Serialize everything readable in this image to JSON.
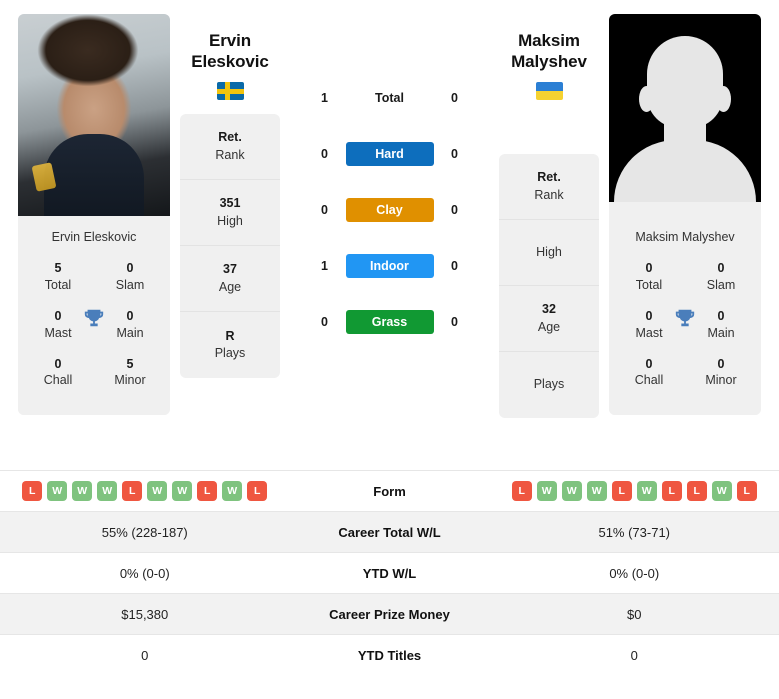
{
  "players": {
    "left": {
      "first_name": "Ervin",
      "last_name": "Eleskovic",
      "full_name": "Ervin Eleskovic",
      "flag": "sweden-flag",
      "photo": "player-portrait",
      "info": [
        {
          "value": "Ret.",
          "label": "Rank"
        },
        {
          "value": "351",
          "label": "High"
        },
        {
          "value": "37",
          "label": "Age"
        },
        {
          "value": "R",
          "label": "Plays"
        }
      ],
      "titles": {
        "total": "5",
        "total_label": "Total",
        "slam": "0",
        "slam_label": "Slam",
        "mast": "0",
        "mast_label": "Mast",
        "main": "0",
        "main_label": "Main",
        "chall": "0",
        "chall_label": "Chall",
        "minor": "5",
        "minor_label": "Minor"
      },
      "form": [
        "L",
        "W",
        "W",
        "W",
        "L",
        "W",
        "W",
        "L",
        "W",
        "L"
      ],
      "career_total_wl": "55% (228-187)",
      "ytd_wl": "0% (0-0)",
      "career_prize_money": "$15,380",
      "ytd_titles": "0"
    },
    "right": {
      "first_name": "Maksim",
      "last_name": "Malyshev",
      "full_name": "Maksim Malyshev",
      "flag": "ukraine-flag",
      "photo": "player-silhouette-placeholder",
      "info": [
        {
          "value": "Ret.",
          "label": "Rank"
        },
        {
          "value": "",
          "label": "High"
        },
        {
          "value": "32",
          "label": "Age"
        },
        {
          "value": "",
          "label": "Plays"
        }
      ],
      "titles": {
        "total": "0",
        "total_label": "Total",
        "slam": "0",
        "slam_label": "Slam",
        "mast": "0",
        "mast_label": "Mast",
        "main": "0",
        "main_label": "Main",
        "chall": "0",
        "chall_label": "Chall",
        "minor": "0",
        "minor_label": "Minor"
      },
      "form": [
        "L",
        "W",
        "W",
        "W",
        "L",
        "W",
        "L",
        "L",
        "W",
        "L"
      ],
      "career_total_wl": "51% (73-71)",
      "ytd_wl": "0% (0-0)",
      "career_prize_money": "$0",
      "ytd_titles": "0"
    }
  },
  "h2h": {
    "rows": [
      {
        "label": "Total",
        "left": "1",
        "right": "0",
        "type": "plain",
        "color": ""
      },
      {
        "label": "Hard",
        "left": "0",
        "right": "0",
        "type": "badge",
        "color": "#0d6ebd"
      },
      {
        "label": "Clay",
        "left": "0",
        "right": "0",
        "type": "badge",
        "color": "#e09000"
      },
      {
        "label": "Indoor",
        "left": "1",
        "right": "0",
        "type": "badge",
        "color": "#2196f3"
      },
      {
        "label": "Grass",
        "left": "0",
        "right": "0",
        "type": "badge",
        "color": "#119933"
      }
    ]
  },
  "table": {
    "rows": [
      {
        "label": "Form",
        "key": "form",
        "shaded": false
      },
      {
        "label": "Career Total W/L",
        "key": "career_total_wl",
        "shaded": true
      },
      {
        "label": "YTD W/L",
        "key": "ytd_wl",
        "shaded": false
      },
      {
        "label": "Career Prize Money",
        "key": "career_prize_money",
        "shaded": true
      },
      {
        "label": "YTD Titles",
        "key": "ytd_titles",
        "shaded": false
      }
    ]
  },
  "colors": {
    "win_badge": "#7fc37f",
    "loss_badge": "#ef5640",
    "trophy": "#4a7ebb",
    "card_bg": "#f0f0f0",
    "row_shade": "#f2f2f2"
  },
  "icons": {
    "trophy": "trophy-icon"
  }
}
